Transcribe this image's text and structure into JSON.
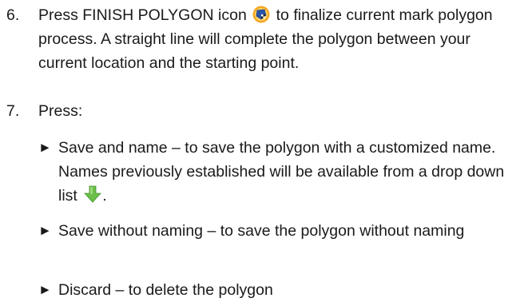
{
  "steps": [
    {
      "number": "6.",
      "text_before_icon": "Press FINISH POLYGON icon",
      "icon": "finish-polygon-icon",
      "text_after_icon": " to finalize current mark polygon process. A straight line will complete the polygon between your current location and the starting point."
    },
    {
      "number": "7.",
      "text": "Press:"
    }
  ],
  "options": [
    {
      "marker": "►",
      "text_before_icon": "Save and name – to save the polygon with a customized name. Names previously established will be available from a drop down list",
      "icon": "down-arrow-icon",
      "text_after_icon": "."
    },
    {
      "marker": "►",
      "text": "Save without naming – to save the polygon without naming"
    },
    {
      "marker": "►",
      "text": "Discard – to delete the polygon"
    }
  ],
  "colors": {
    "text": "#1a1a1a",
    "icon_blue": "#2a56a8",
    "icon_orange": "#f5a623",
    "arrow_green": "#6cc04a"
  }
}
